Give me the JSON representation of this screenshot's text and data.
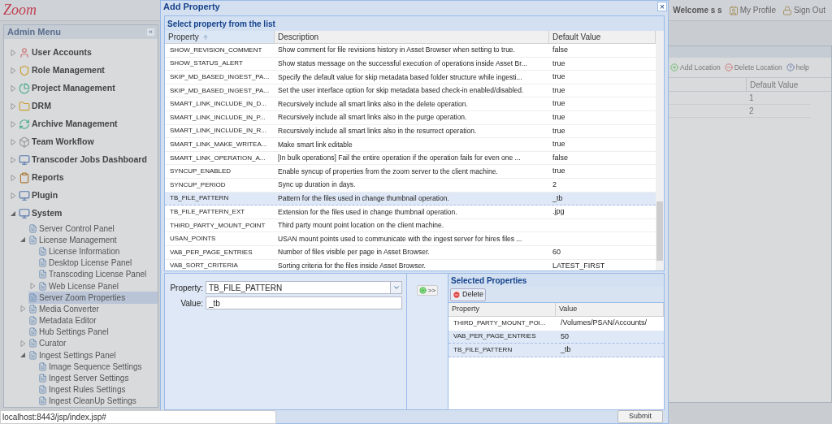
{
  "app": {
    "logo": "Zoom",
    "status_url": "localhost:8443/jsp/index.jsp#"
  },
  "header": {
    "welcome": "Welcome s s",
    "links": [
      "My Profile",
      "Sign Out"
    ]
  },
  "sidebar": {
    "title": "Admin Menu",
    "collapse_label": "«",
    "items": [
      {
        "label": "User Accounts",
        "expanded": false,
        "selected": false
      },
      {
        "label": "Role Management",
        "expanded": false,
        "selected": false
      },
      {
        "label": "Project Management",
        "expanded": false,
        "selected": false
      },
      {
        "label": "DRM",
        "expanded": false,
        "selected": false
      },
      {
        "label": "Archive Management",
        "expanded": false,
        "selected": false
      },
      {
        "label": "Team Workflow",
        "expanded": false,
        "selected": false
      },
      {
        "label": "Transcoder Jobs Dashboard",
        "expanded": false,
        "selected": false
      },
      {
        "label": "Reports",
        "expanded": false,
        "selected": false
      },
      {
        "label": "Plugin",
        "expanded": false,
        "selected": false
      },
      {
        "label": "System",
        "expanded": true,
        "selected": false,
        "children": [
          {
            "label": "Server Control Panel",
            "selected": false
          },
          {
            "label": "License Management",
            "expanded": true,
            "selected": false,
            "children": [
              {
                "label": "License Information",
                "selected": false
              },
              {
                "label": "Desktop License Panel",
                "selected": false
              },
              {
                "label": "Transcoding License Panel",
                "selected": false
              },
              {
                "label": "Web License Panel",
                "expanded": false,
                "selected": false
              }
            ]
          },
          {
            "label": "Server Zoom Properties",
            "selected": true
          },
          {
            "label": "Media Converter",
            "expanded": false,
            "selected": false
          },
          {
            "label": "Metadata Editor",
            "selected": false
          },
          {
            "label": "Hub Settings Panel",
            "selected": false
          },
          {
            "label": "Curator",
            "expanded": false,
            "selected": false
          },
          {
            "label": "Ingest Settings Panel",
            "expanded": true,
            "selected": false,
            "children": [
              {
                "label": "Image Sequence Settings",
                "selected": false
              },
              {
                "label": "Ingest Server Settings",
                "selected": false
              },
              {
                "label": "Ingest Rules Settings",
                "selected": false
              },
              {
                "label": "Ingest CleanUp Settings",
                "selected": false
              }
            ]
          }
        ]
      }
    ]
  },
  "background_panel": {
    "toolbar": [
      "Add Location",
      "Delete Location",
      "help"
    ],
    "column": "Default Value",
    "rows": [
      "1",
      "2"
    ]
  },
  "dialog": {
    "title": "Add Property",
    "close": "×",
    "list_title": "Select property from the list",
    "columns": [
      "Property",
      "Description",
      "Default Value"
    ],
    "rows": [
      {
        "property": "SHOW_REVISION_COMMENT",
        "description": "Show comment for file revisions history in Asset Browser when setting to true.",
        "value": "false",
        "selected": false
      },
      {
        "property": "SHOW_STATUS_ALERT",
        "description": "Show status message on the successful execution of operations inside Asset Br...",
        "value": "true",
        "selected": false
      },
      {
        "property": "SKIP_MD_BASED_INGEST_PA...",
        "description": "Specify the default value for skip metadata based folder structure while ingesti...",
        "value": "true",
        "selected": false
      },
      {
        "property": "SKIP_MD_BASED_INGEST_PA...",
        "description": "Set the user interface option for skip metadata based check-in enabled/disabled.",
        "value": "true",
        "selected": false
      },
      {
        "property": "SMART_LINK_INCLUDE_IN_D...",
        "description": "Recursively include all smart links also in the delete operation.",
        "value": "true",
        "selected": false
      },
      {
        "property": "SMART_LINK_INCLUDE_IN_P...",
        "description": "Recursively include all smart links also in the purge operation.",
        "value": "true",
        "selected": false
      },
      {
        "property": "SMART_LINK_INCLUDE_IN_R...",
        "description": "Recursively include all smart links also in the resurrect operation.",
        "value": "true",
        "selected": false
      },
      {
        "property": "SMART_LINK_MAKE_WRITEA...",
        "description": "Make smart link editable",
        "value": "true",
        "selected": false
      },
      {
        "property": "SMART_LINK_OPERATION_A...",
        "description": "[In bulk operations] Fail the entire operation if the operation fails for even one ...",
        "value": "false",
        "selected": false
      },
      {
        "property": "SYNCUP_ENABLED",
        "description": "Enable syncup of properties from the zoom server to the client machine.",
        "value": "true",
        "selected": false
      },
      {
        "property": "SYNCUP_PERIOD",
        "description": "Sync up duration in days.",
        "value": "2",
        "selected": false
      },
      {
        "property": "TB_FILE_PATTERN",
        "description": "Pattern for the files used in change thumbnail operation.",
        "value": "_tb",
        "selected": true
      },
      {
        "property": "TB_FILE_PATTERN_EXT",
        "description": "Extension for the files used in change thumbnail operation.",
        "value": ".jpg",
        "selected": false
      },
      {
        "property": "THIRD_PARTY_MOUNT_POINT",
        "description": "Third party mount point location on the client machine.",
        "selected": false
      },
      {
        "property": "USAN_POINTS",
        "description": "USAN mount points used to communicate with the ingest server for hires files ...",
        "selected": false
      },
      {
        "property": "VAB_PER_PAGE_ENTRIES",
        "description": "Number of files visible per page in Asset Browser.",
        "value": "60",
        "selected": false
      },
      {
        "property": "VAB_SORT_CRITERIA",
        "description": "Sorting criteria for the files inside Asset Browser.",
        "value": "LATEST_FIRST",
        "selected": false
      }
    ],
    "form": {
      "property_label": "Property:",
      "property_value": "TB_FILE_PATTERN",
      "value_label": "Value:",
      "value": "_tb"
    },
    "add_button": ">>",
    "selected_panel": {
      "title": "Selected Properties",
      "delete_button": "Delete",
      "columns": [
        "Property",
        "Value"
      ],
      "rows": [
        {
          "property": "THIRD_PARTY_MOUNT_POI...",
          "value": "/Volumes/PSAN/Accounts/",
          "selected": false
        },
        {
          "property": "VAB_PER_PAGE_ENTRIES",
          "value": "50",
          "selected": true
        },
        {
          "property": "TB_FILE_PATTERN",
          "value": "_tb",
          "selected": true
        }
      ]
    },
    "submit": "Submit"
  }
}
